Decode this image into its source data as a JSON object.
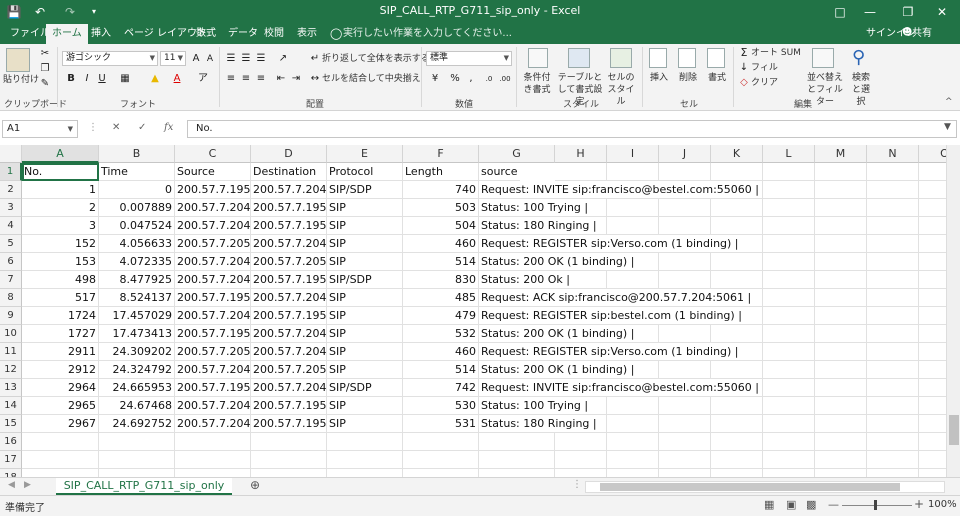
{
  "window": {
    "title": "SIP_CALL_RTP_G711_sip_only - Excel",
    "signin": "サインイン",
    "share": "共有"
  },
  "colors": {
    "accent": "#217346"
  },
  "tabs": [
    "ファイル",
    "ホーム",
    "挿入",
    "ページ レイアウト",
    "数式",
    "データ",
    "校閲",
    "表示"
  ],
  "tellme": "実行したい作業を入力してください...",
  "ribbon": {
    "clipboard": {
      "paste": "貼り付け",
      "label": "クリップボード"
    },
    "font": {
      "name": "游ゴシック",
      "size": "11",
      "label": "フォント"
    },
    "alignment": {
      "wrap": "折り返して全体を表示する",
      "merge": "セルを結合して中央揃え",
      "label": "配置"
    },
    "number": {
      "format": "標準",
      "label": "数値"
    },
    "styles": {
      "cond": "条件付き書式",
      "table": "テーブルとして書式設定",
      "cell": "セルのスタイル",
      "label": "スタイル"
    },
    "cells": {
      "insert": "挿入",
      "delete": "削除",
      "format": "書式",
      "label": "セル"
    },
    "editing": {
      "autosum": "オート SUM",
      "fill": "フィル",
      "clear": "クリア",
      "sort": "並べ替えとフィルター",
      "find": "検索と選択",
      "label": "編集"
    }
  },
  "formula_bar": {
    "name_box": "A1",
    "content": "No."
  },
  "sheet": {
    "columns": [
      "A",
      "B",
      "C",
      "D",
      "E",
      "F",
      "G",
      "H",
      "I",
      "J",
      "K",
      "L",
      "M",
      "N",
      "O"
    ],
    "row_numbers": [
      "1",
      "2",
      "3",
      "4",
      "5",
      "6",
      "7",
      "8",
      "9",
      "10",
      "11",
      "12",
      "13",
      "14",
      "15",
      "16",
      "17",
      "18"
    ],
    "header": [
      "No.",
      "Time",
      "Source",
      "Destination",
      "Protocol",
      "Length",
      "source"
    ],
    "rows": [
      [
        "1",
        "0",
        "200.57.7.195",
        "200.57.7.204",
        "SIP/SDP",
        "740",
        "Request: INVITE sip:francisco@bestel.com:55060 |"
      ],
      [
        "2",
        "0.007889",
        "200.57.7.204",
        "200.57.7.195",
        "SIP",
        "503",
        "Status: 100 Trying |"
      ],
      [
        "3",
        "0.047524",
        "200.57.7.204",
        "200.57.7.195",
        "SIP",
        "504",
        "Status: 180 Ringing |"
      ],
      [
        "152",
        "4.056633",
        "200.57.7.205",
        "200.57.7.204",
        "SIP",
        "460",
        "Request: REGISTER sip:Verso.com  (1 binding) |"
      ],
      [
        "153",
        "4.072335",
        "200.57.7.204",
        "200.57.7.205",
        "SIP",
        "514",
        "Status: 200 OK  (1 binding) |"
      ],
      [
        "498",
        "8.477925",
        "200.57.7.204",
        "200.57.7.195",
        "SIP/SDP",
        "830",
        "Status: 200 Ok |"
      ],
      [
        "517",
        "8.524137",
        "200.57.7.195",
        "200.57.7.204",
        "SIP",
        "485",
        "Request: ACK sip:francisco@200.57.7.204:5061 |"
      ],
      [
        "1724",
        "17.457029",
        "200.57.7.204",
        "200.57.7.195",
        "SIP",
        "479",
        "Request: REGISTER sip:bestel.com  (1 binding) |"
      ],
      [
        "1727",
        "17.473413",
        "200.57.7.195",
        "200.57.7.204",
        "SIP",
        "532",
        "Status: 200 OK  (1 binding) |"
      ],
      [
        "2911",
        "24.309202",
        "200.57.7.205",
        "200.57.7.204",
        "SIP",
        "460",
        "Request: REGISTER sip:Verso.com  (1 binding) |"
      ],
      [
        "2912",
        "24.324792",
        "200.57.7.204",
        "200.57.7.205",
        "SIP",
        "514",
        "Status: 200 OK  (1 binding) |"
      ],
      [
        "2964",
        "24.665953",
        "200.57.7.195",
        "200.57.7.204",
        "SIP/SDP",
        "742",
        "Request: INVITE sip:francisco@bestel.com:55060 |"
      ],
      [
        "2965",
        "24.67468",
        "200.57.7.204",
        "200.57.7.195",
        "SIP",
        "530",
        "Status: 100 Trying |"
      ],
      [
        "2967",
        "24.692752",
        "200.57.7.204",
        "200.57.7.195",
        "SIP",
        "531",
        "Status: 180 Ringing |"
      ]
    ]
  },
  "sheet_tab": "SIP_CALL_RTP_G711_sip_only",
  "status": {
    "ready": "準備完了",
    "zoom": "100%"
  }
}
